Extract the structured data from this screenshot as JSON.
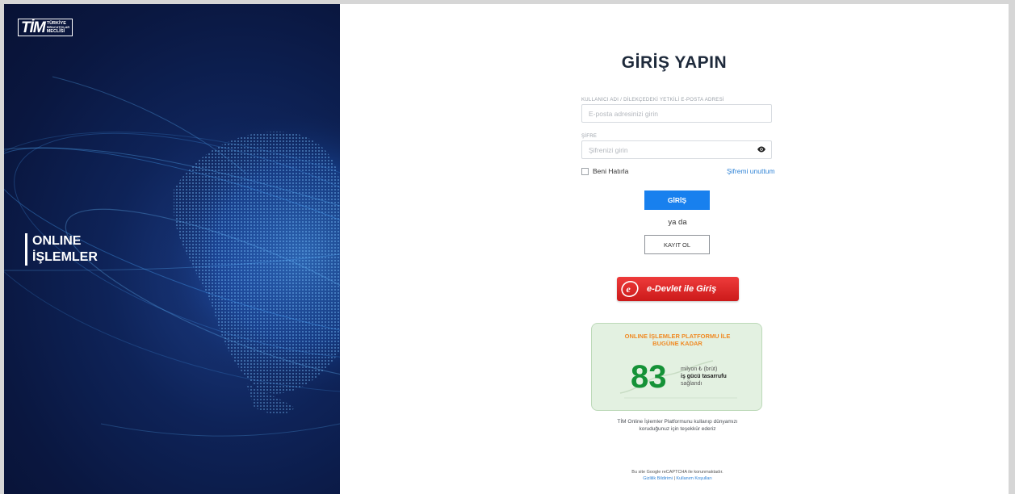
{
  "brand": {
    "logo_mark": "TİM",
    "logo_lines": [
      "TÜRKİYE",
      "İHRACATÇILAR",
      "MECLİSİ"
    ]
  },
  "left_panel": {
    "title_line1": "ONLINE",
    "title_line2": "İŞLEMLER"
  },
  "login": {
    "title": "GİRİŞ YAPIN",
    "email_label": "KULLANICI ADI / DİLEKÇEDEKİ YETKİLİ E-POSTA ADRESİ",
    "email_placeholder": "E-posta adresinizi girin",
    "email_value": "",
    "password_label": "ŞİFRE",
    "password_placeholder": "Şifrenizi girin",
    "password_value": "",
    "remember_label": "Beni Hatırla",
    "remember_checked": false,
    "forgot_label": "Şifremi unuttum",
    "submit_label": "GİRİŞ",
    "or_label": "ya da",
    "register_label": "KAYIT OL",
    "edevlet_label": "e-Devlet ile Giriş"
  },
  "stats": {
    "title_line1": "ONLINE İŞLEMLER PLATFORMU İLE",
    "title_line2": "BUGÜNE KADAR",
    "number": "83",
    "desc_line1": "milyon ₺ (brüt)",
    "desc_line2": "iş gücü tasarrufu",
    "desc_line3": "sağlandı"
  },
  "thanks": {
    "line1": "TİM Online İşlemler Platformunu kullanıp dünyamızı",
    "line2": "koruduğunuz için teşekkür ederiz"
  },
  "recaptcha": {
    "text": "Bu site Google reCAPTCHA ile korunmaktadır.",
    "privacy_link": "Gizlilik Bildirimi",
    "separator": " | ",
    "terms_link": "Kullanım Koşulları"
  },
  "colors": {
    "left_bg": "#0a1740",
    "primary_button": "#1880ee",
    "link": "#2f83d6",
    "edevlet_red": "#e12b2b",
    "stats_orange": "#f08a24",
    "stats_green": "#159237"
  }
}
